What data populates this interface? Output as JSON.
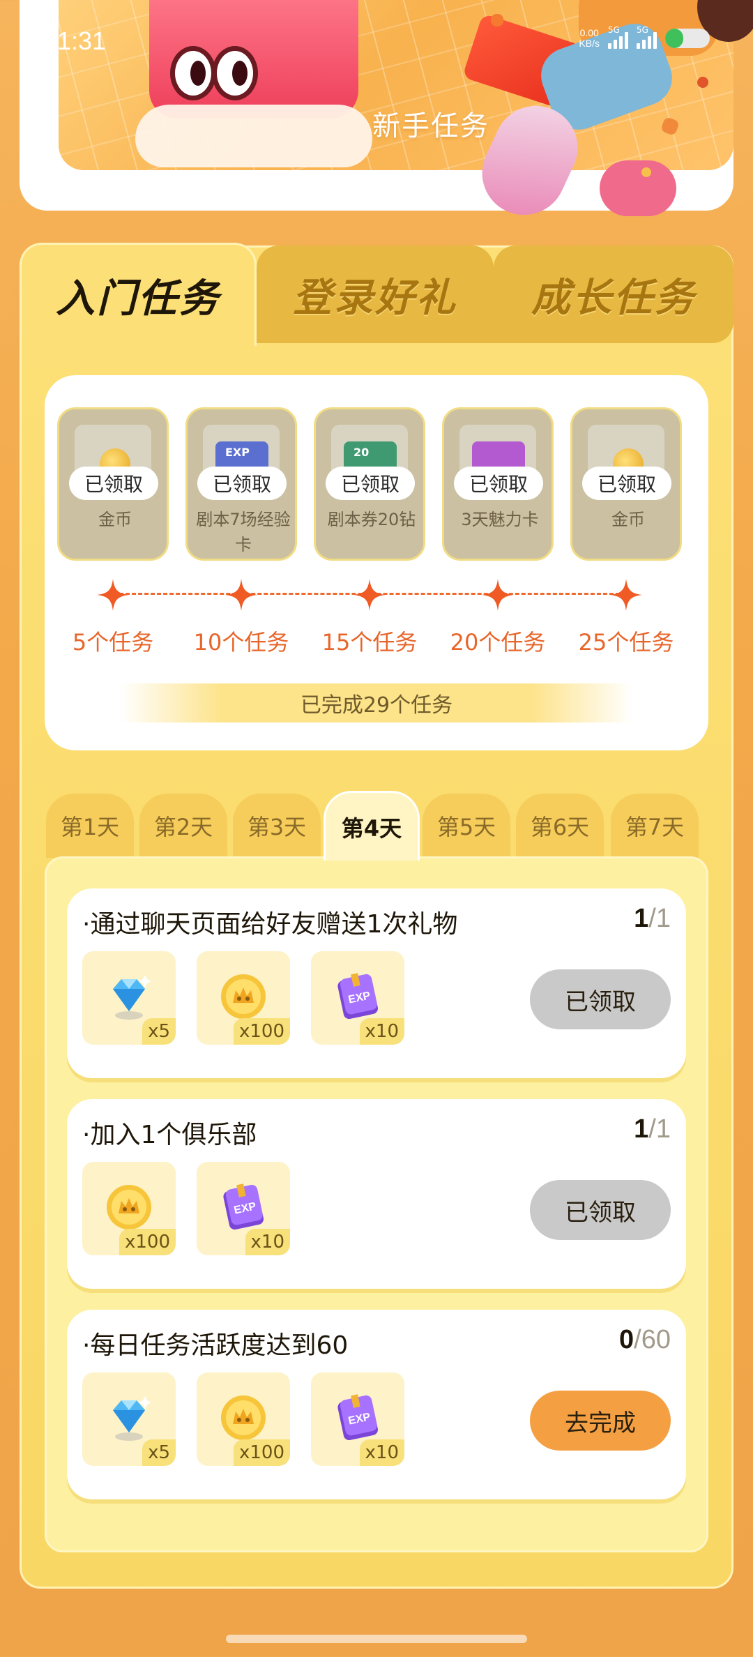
{
  "status_bar": {
    "time": "1:31",
    "net_speed_value": "0.00",
    "net_speed_unit": "KB/s",
    "sim1_label": "5G",
    "sim2_label": "5G",
    "battery_level": 0.4
  },
  "banner": {
    "title": "新手任务"
  },
  "category_tabs": [
    {
      "label": "入门任务",
      "active": true
    },
    {
      "label": "登录好礼",
      "active": false
    },
    {
      "label": "成长任务",
      "active": false
    }
  ],
  "milestones": {
    "rewards": [
      {
        "name": "金币",
        "status": "已领取",
        "icon": "coin-icon"
      },
      {
        "name": "剧本7场经验卡",
        "status": "已领取",
        "icon": "exp-card-icon"
      },
      {
        "name": "剧本券20钻",
        "status": "已领取",
        "icon": "ticket-icon"
      },
      {
        "name": "3天魅力卡",
        "status": "已领取",
        "icon": "charm-card-icon"
      },
      {
        "name": "金币",
        "status": "已领取",
        "icon": "coin-icon"
      }
    ],
    "steps": [
      "5个任务",
      "10个任务",
      "15个任务",
      "20个任务",
      "25个任务"
    ],
    "completed_text": "已完成29个任务"
  },
  "day_tabs": [
    {
      "label": "第1天",
      "active": false
    },
    {
      "label": "第2天",
      "active": false
    },
    {
      "label": "第3天",
      "active": false
    },
    {
      "label": "第4天",
      "active": true
    },
    {
      "label": "第5天",
      "active": false
    },
    {
      "label": "第6天",
      "active": false
    },
    {
      "label": "第7天",
      "active": false
    }
  ],
  "tasks": [
    {
      "title": "·通过聊天页面给好友赠送1次礼物",
      "progress_current": "1",
      "progress_sep": "/",
      "progress_total": "1",
      "rewards": [
        {
          "icon": "diamond-icon",
          "qty": "x5"
        },
        {
          "icon": "coin-icon",
          "qty": "x100"
        },
        {
          "icon": "exp-book-icon",
          "qty": "x10"
        }
      ],
      "button_label": "已领取",
      "button_state": "claimed"
    },
    {
      "title": "·加入1个俱乐部",
      "progress_current": "1",
      "progress_sep": "/",
      "progress_total": "1",
      "rewards": [
        {
          "icon": "coin-icon",
          "qty": "x100"
        },
        {
          "icon": "exp-book-icon",
          "qty": "x10"
        }
      ],
      "button_label": "已领取",
      "button_state": "claimed"
    },
    {
      "title": "·每日任务活跃度达到60",
      "progress_current": "0",
      "progress_sep": "/",
      "progress_total": "60",
      "rewards": [
        {
          "icon": "diamond-icon",
          "qty": "x5"
        },
        {
          "icon": "coin-icon",
          "qty": "x100"
        },
        {
          "icon": "exp-book-icon",
          "qty": "x10"
        }
      ],
      "button_label": "去完成",
      "button_state": "todo"
    }
  ],
  "colors": {
    "accent_orange": "#f4a042",
    "milestone_orange": "#ef5a25",
    "panel_yellow": "#fce077",
    "claimed_gray": "#c9c9c9"
  }
}
